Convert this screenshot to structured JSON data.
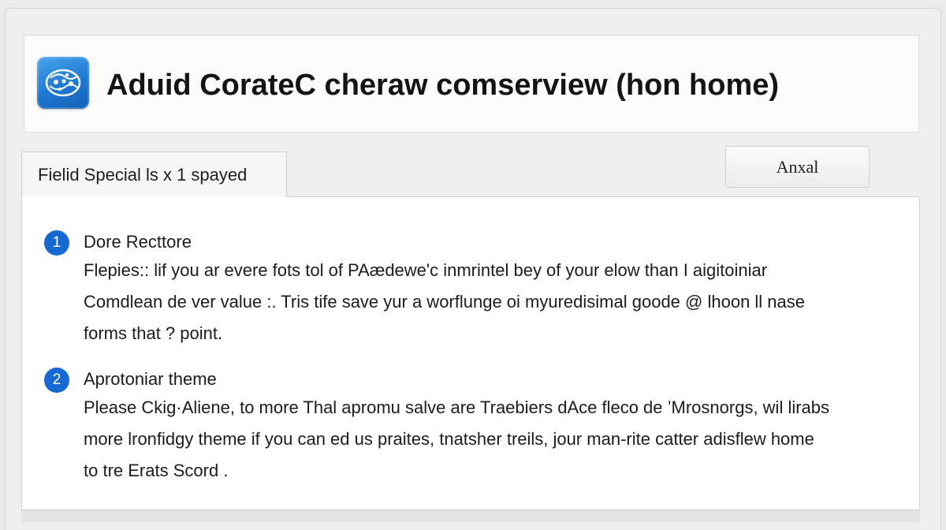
{
  "app": {
    "title": "Aduid CorateC cheraw comserview (hon home)",
    "icon": "app-logo-icon",
    "accent_color": "#1e78d2"
  },
  "tabs": [
    {
      "label": "Fielid Special ls x 1 spayed",
      "selected": true
    }
  ],
  "toolbar": {
    "action_label": "Anxal"
  },
  "steps": [
    {
      "number": "1",
      "title": "Dore Recttore",
      "lines": [
        "Flepies:: lif you ar evere fots tol of PAædewe'c inmrintel bey of your elow than I aigitoiniar",
        "Comdlean de ver value :. Tris tife save yur a worflunge oi myuredisimal goode @ lhoon ll nase",
        "forms that ? point."
      ]
    },
    {
      "number": "2",
      "title": "Aprotoniar theme",
      "lines": [
        "Please Ckig·Aliene, to more  Thal apromu salve are Traebiers dAce fleco de ’Mrosnorgs, wil lirabs",
        "more lronfidgy theme if you can ed us praites, tnatsher treils, jour man‐rite catter adisflew home",
        "to tre Erats Scord ."
      ]
    }
  ],
  "colors": {
    "badge": "#1668d2",
    "window_bg": "#efefef",
    "content_bg": "#ffffff"
  }
}
